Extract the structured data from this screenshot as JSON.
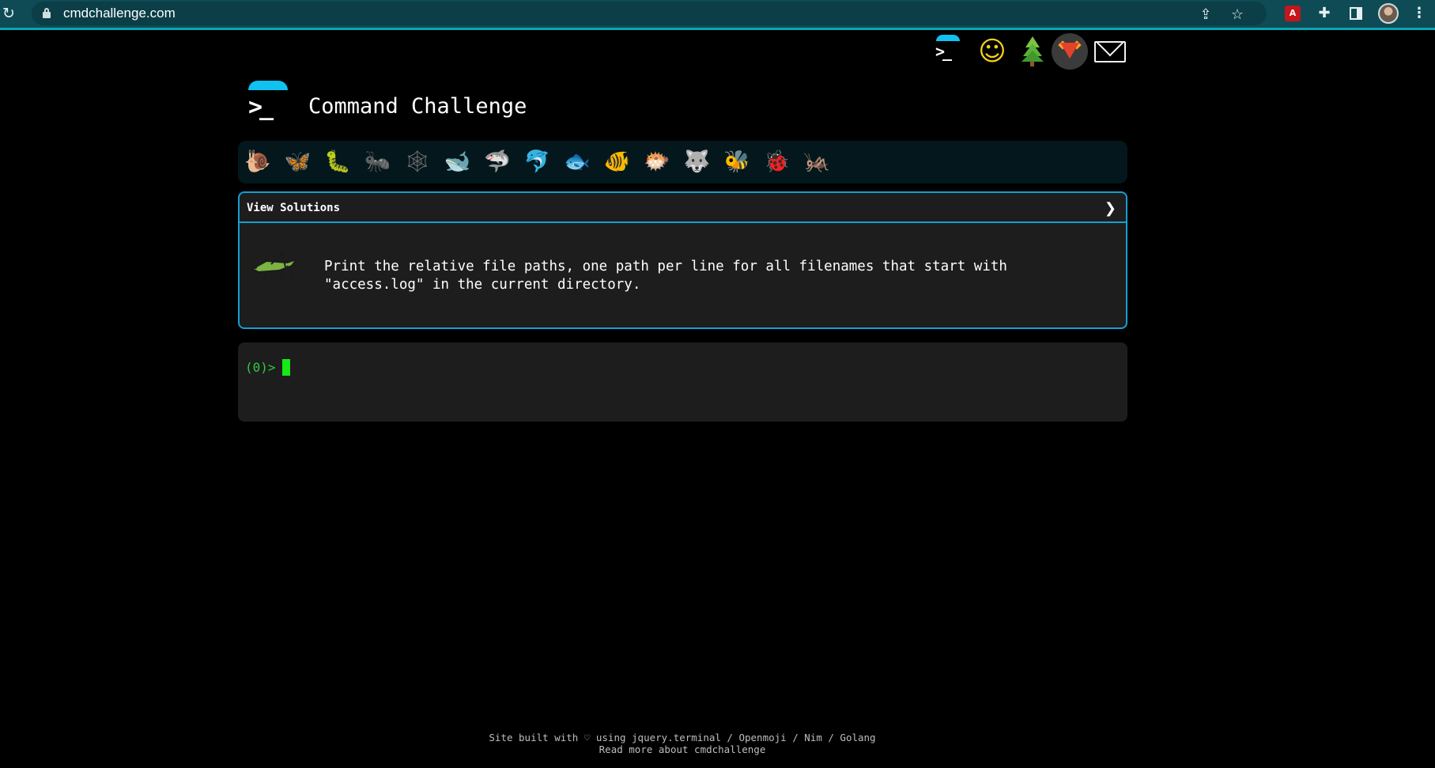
{
  "browser": {
    "url": "cmdchallenge.com",
    "icons": [
      "reload-icon",
      "share-icon",
      "star-icon",
      "pdf-extension-icon",
      "extensions-icon",
      "side-panel-icon",
      "profile-avatar",
      "menu-icon"
    ]
  },
  "top_nav": {
    "icons": [
      "terminal-logo-icon",
      "shushing-face-icon",
      "evergreen-tree-icon",
      "gitlab-icon",
      "envelope-icon"
    ]
  },
  "header": {
    "title": "Command Challenge"
  },
  "animals": [
    {
      "name": "snail-icon",
      "glyph": "🐌",
      "color": "#8a6a3a"
    },
    {
      "name": "butterfly-icon",
      "glyph": "🦋",
      "color": "#e07a2c"
    },
    {
      "name": "caterpillar-icon",
      "glyph": "🐛",
      "color": "#7cb342"
    },
    {
      "name": "ant-icon",
      "glyph": "🐜",
      "color": "#3b3b3b"
    },
    {
      "name": "spider-web-icon",
      "glyph": "🕸",
      "color": "#6b6b6b"
    },
    {
      "name": "whale-icon",
      "glyph": "🐋",
      "color": "#3a88c2"
    },
    {
      "name": "shark-icon",
      "glyph": "🦈",
      "color": "#3a88c2"
    },
    {
      "name": "dolphin-icon",
      "glyph": "🐬",
      "color": "#7f8a93"
    },
    {
      "name": "fish-icon",
      "glyph": "🐟",
      "color": "#4aa3df"
    },
    {
      "name": "tropical-fish-icon",
      "glyph": "🐠",
      "color": "#f2c200"
    },
    {
      "name": "blowfish-icon",
      "glyph": "🐡",
      "color": "#8a6a3a"
    },
    {
      "name": "wolf-icon",
      "glyph": "🐺",
      "color": "#7d7d7d"
    },
    {
      "name": "bee-icon",
      "glyph": "🐝",
      "color": "#f4d03f"
    },
    {
      "name": "ladybug-icon",
      "glyph": "🐞",
      "color": "#d0312d"
    },
    {
      "name": "grasshopper-icon",
      "glyph": "🦗",
      "color": "#7cb342"
    }
  ],
  "challenge": {
    "view_solutions": "View Solutions",
    "chevron": "❯",
    "description_line1": "Print the relative file paths, one path per line for all filenames that start with",
    "description_line2": "\"access.log\" in the current directory."
  },
  "terminal": {
    "prompt": "(0)>"
  },
  "footer": {
    "line1": "Site built with ♡ using jquery.terminal / Openmoji / Nim / Golang",
    "line2": "Read more about cmdchallenge"
  }
}
